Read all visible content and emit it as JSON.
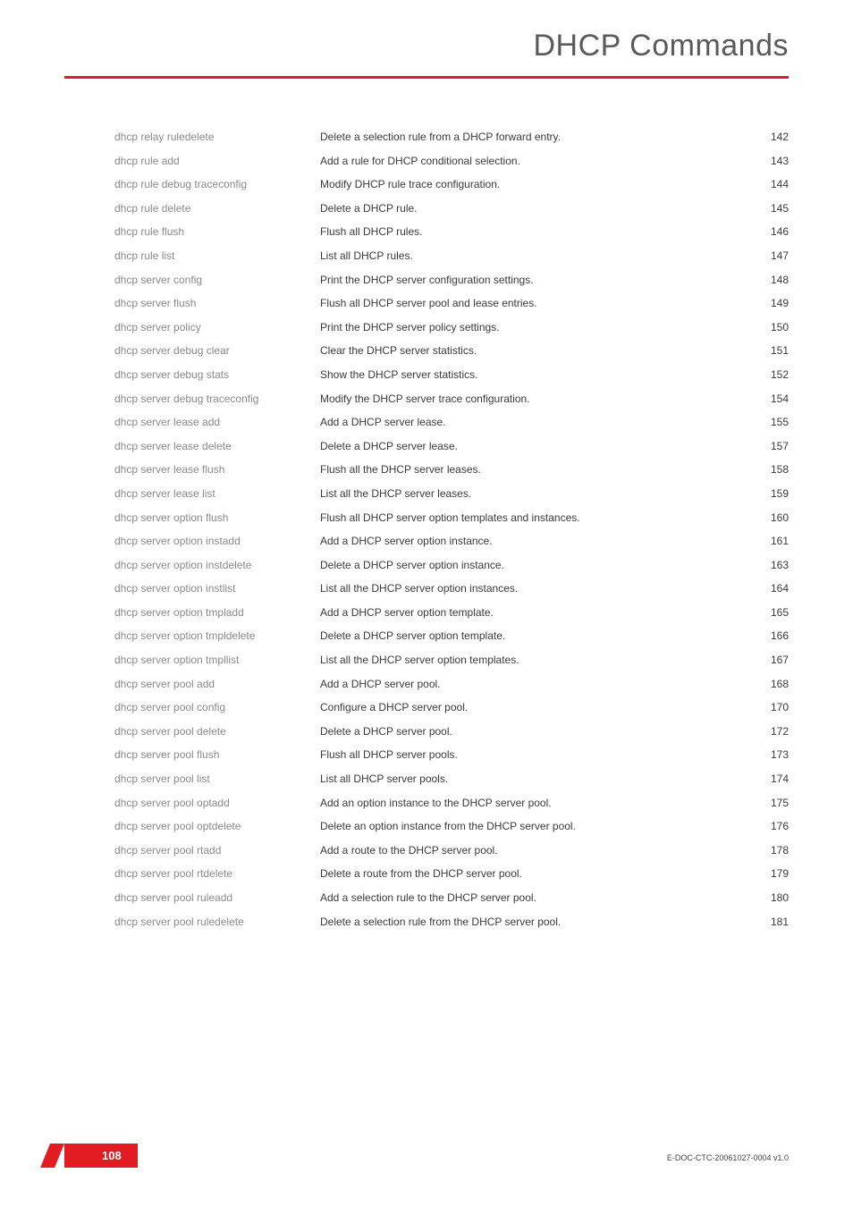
{
  "header": {
    "title": "DHCP Commands"
  },
  "footer": {
    "page_number": "108",
    "doc_id": "E-DOC-CTC-20061027-0004 v1.0"
  },
  "toc": [
    {
      "cmd": "dhcp relay ruledelete",
      "desc": "Delete a selection rule from a DHCP forward entry.",
      "pg": "142"
    },
    {
      "cmd": "dhcp rule add",
      "desc": "Add a rule for DHCP conditional selection.",
      "pg": "143"
    },
    {
      "cmd": "dhcp rule debug traceconfig",
      "desc": "Modify DHCP rule trace configuration.",
      "pg": "144"
    },
    {
      "cmd": "dhcp rule delete",
      "desc": "Delete a DHCP rule.",
      "pg": "145"
    },
    {
      "cmd": "dhcp rule flush",
      "desc": "Flush all DHCP rules.",
      "pg": "146"
    },
    {
      "cmd": "dhcp rule list",
      "desc": "List all DHCP rules.",
      "pg": "147"
    },
    {
      "cmd": "dhcp server config",
      "desc": "Print the DHCP server configuration settings.",
      "pg": "148"
    },
    {
      "cmd": "dhcp server flush",
      "desc": "Flush all DHCP server pool and lease entries.",
      "pg": "149"
    },
    {
      "cmd": "dhcp server policy",
      "desc": "Print the DHCP server policy settings.",
      "pg": "150"
    },
    {
      "cmd": "dhcp server debug clear",
      "desc": "Clear the DHCP server statistics.",
      "pg": "151"
    },
    {
      "cmd": "dhcp server debug stats",
      "desc": "Show the DHCP server statistics.",
      "pg": "152"
    },
    {
      "cmd": "dhcp server debug traceconfig",
      "desc": "Modify the DHCP server trace configuration.",
      "pg": "154"
    },
    {
      "cmd": "dhcp server lease add",
      "desc": "Add a DHCP server lease.",
      "pg": "155"
    },
    {
      "cmd": "dhcp server lease delete",
      "desc": "Delete a DHCP server lease.",
      "pg": "157"
    },
    {
      "cmd": "dhcp server lease flush",
      "desc": "Flush all the DHCP server leases.",
      "pg": "158"
    },
    {
      "cmd": "dhcp server lease list",
      "desc": "List all the DHCP server leases.",
      "pg": "159"
    },
    {
      "cmd": "dhcp server option flush",
      "desc": "Flush all DHCP server option templates and instances.",
      "pg": "160"
    },
    {
      "cmd": "dhcp server option instadd",
      "desc": "Add a DHCP server option instance.",
      "pg": "161"
    },
    {
      "cmd": "dhcp server option instdelete",
      "desc": "Delete a DHCP server option instance.",
      "pg": "163"
    },
    {
      "cmd": "dhcp server option instlist",
      "desc": "List all the DHCP server option instances.",
      "pg": "164"
    },
    {
      "cmd": "dhcp server option tmpladd",
      "desc": "Add a DHCP server option template.",
      "pg": "165"
    },
    {
      "cmd": "dhcp server option tmpldelete",
      "desc": "Delete a DHCP server option template.",
      "pg": "166"
    },
    {
      "cmd": "dhcp server option tmpllist",
      "desc": "List all the DHCP server option templates.",
      "pg": "167"
    },
    {
      "cmd": "dhcp server pool add",
      "desc": "Add a DHCP server pool.",
      "pg": "168"
    },
    {
      "cmd": "dhcp server pool config",
      "desc": "Configure a DHCP server pool.",
      "pg": "170"
    },
    {
      "cmd": "dhcp server pool delete",
      "desc": "Delete a DHCP server pool.",
      "pg": "172"
    },
    {
      "cmd": "dhcp server pool flush",
      "desc": "Flush all DHCP server pools.",
      "pg": "173"
    },
    {
      "cmd": "dhcp server pool list",
      "desc": "List all DHCP server pools.",
      "pg": "174"
    },
    {
      "cmd": "dhcp server pool optadd",
      "desc": "Add an option instance to the DHCP server pool.",
      "pg": "175"
    },
    {
      "cmd": "dhcp server pool optdelete",
      "desc": "Delete an option instance from the DHCP server pool.",
      "pg": "176"
    },
    {
      "cmd": "dhcp server pool rtadd",
      "desc": "Add a route to the DHCP server pool.",
      "pg": "178"
    },
    {
      "cmd": "dhcp server pool rtdelete",
      "desc": "Delete a route from the DHCP server pool.",
      "pg": "179"
    },
    {
      "cmd": "dhcp server pool ruleadd",
      "desc": "Add a selection rule to the DHCP server pool.",
      "pg": "180"
    },
    {
      "cmd": "dhcp server pool ruledelete",
      "desc": "Delete a selection rule from the DHCP server pool.",
      "pg": "181"
    }
  ]
}
